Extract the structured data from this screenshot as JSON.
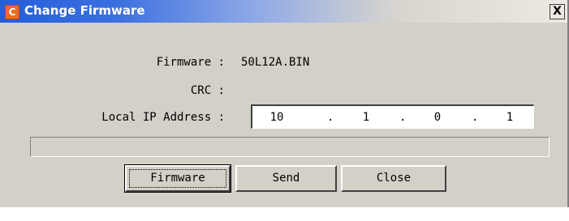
{
  "window": {
    "title": "Change Firmware",
    "icon_letter": "C",
    "close_label": "X"
  },
  "fields": {
    "firmware_label": "Firmware :",
    "firmware_value": "50L12A.BIN",
    "crc_label": "CRC :",
    "crc_value": "",
    "ip_label": "Local IP Address :",
    "ip_octets": [
      "10",
      "1",
      "0",
      "1"
    ],
    "ip_separator": "."
  },
  "progress": {
    "fraction": 0
  },
  "buttons": {
    "firmware": "Firmware",
    "send": "Send",
    "close": "Close"
  },
  "colors": {
    "dialog_face": "#d4d0c8",
    "titlebar_start": "#245edb",
    "accent_icon": "#f26a21"
  },
  "icons": {
    "app": "firmware-app-icon",
    "close": "close-icon"
  }
}
